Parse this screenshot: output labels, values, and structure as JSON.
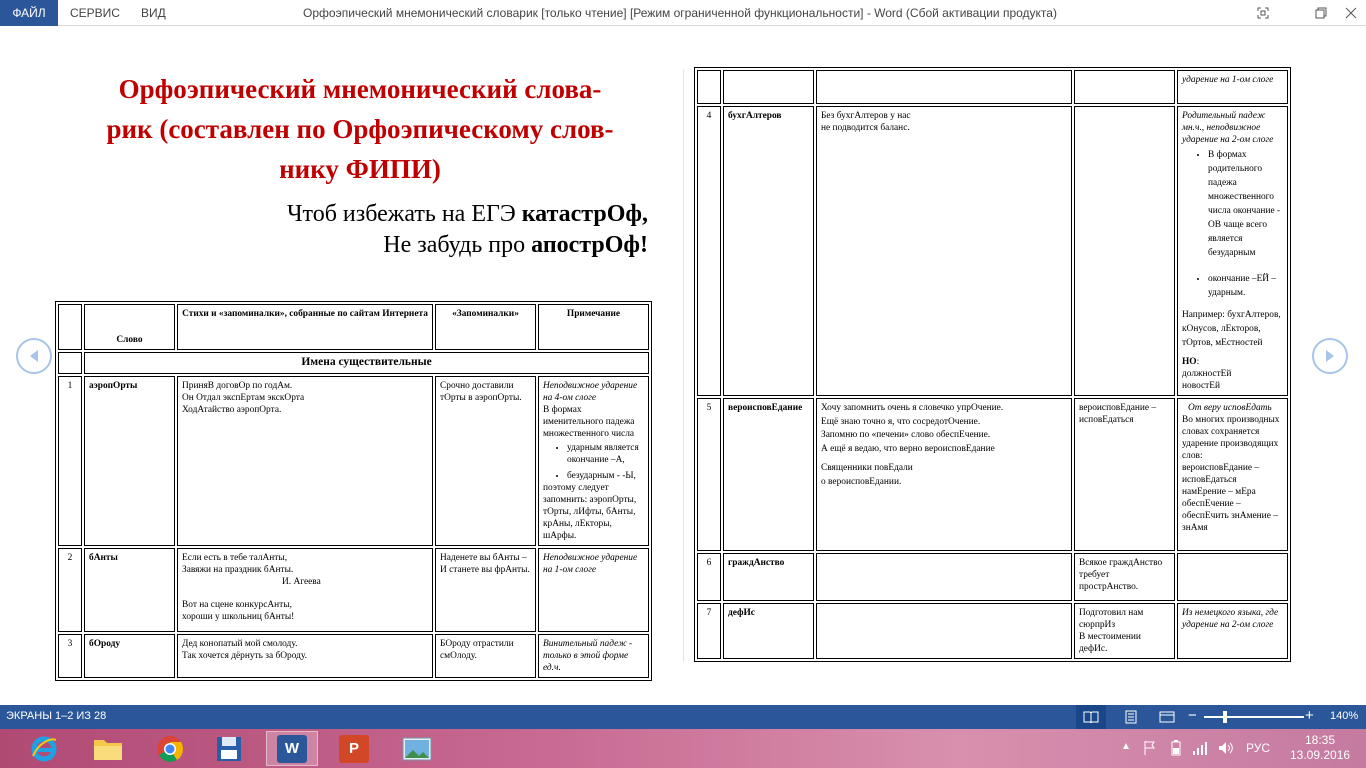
{
  "menu": {
    "file": "ФАЙЛ",
    "service": "СЕРВИС",
    "view": "ВИД"
  },
  "window": {
    "title": "Орфоэпический мнемонический словарик [только чтение] [Режим ограниченной функциональности] - Word (Сбой активации продукта)"
  },
  "doc": {
    "title_l1": "Орфоэпический мнемонический слова-",
    "title_l2": "рик (составлен по Орфоэпическому  слов-",
    "title_l3": "нику  ФИПИ)",
    "epi_l1_pre": "Чтоб избежать на ЕГЭ ",
    "epi_l1_bold": "катастрОф,",
    "epi_l2_pre": "Не забудь про ",
    "epi_l2_bold": "апострОф!"
  },
  "table1": {
    "h_word": "Слово",
    "h_poems": "Стихи и «запоминалки», собранные по сайтам Интернета",
    "h_mnem": "«Запоминалки»",
    "h_note": "Примечание",
    "section": "Имена существительные",
    "r1": {
      "n": "1",
      "word": "аэропОрты",
      "poem": [
        "ПриняВ договОр по годАм.",
        "Он Отдал экспЕртам экскОрта",
        "ХодАтайство аэропОрта."
      ],
      "mnem": "Срочно доставили тОрты в аэропОрты.",
      "note_i": "Неподвижное  ударение на 4-ом слоге",
      "note_t": "В формах именительного падежа множественного числа",
      "note_li1": "ударным является окончание –А,",
      "note_li2": "безударным - -Ы,",
      "note_t2": "поэтому следует запомнить: аэропОрты, тОрты, лИфты, бАнты, крАны, лЕкторы, шАрфы."
    },
    "r2": {
      "n": "2",
      "word": "бАнты",
      "poem1": [
        "Если есть в тебе талАнты,",
        "Завяжи на праздник бАнты."
      ],
      "author": "И.  Агеева",
      "poem2": [
        "Вот на сцене конкурсАнты,",
        "хороши у школьниц бАнты!"
      ],
      "mnem": "Наденете вы бАнты – И станете вы фрАнты.",
      "note_i": "Неподвижное  ударение на 1-ом слоге"
    },
    "r3": {
      "n": "3",
      "word": "бОроду",
      "poem": [
        "Дед конопатый мой смолоду.",
        "Так хочется дёрнуть за бОроду."
      ],
      "mnem": "БОроду отрастили смОлоду.",
      "note_i": "Винительный  падеж - только в этой форме ед.ч."
    }
  },
  "table2": {
    "r0": {
      "note_i": "ударение на 1-ом слоге"
    },
    "r4": {
      "n": "4",
      "word": "бухгАлтеров",
      "poem": [
        "Без бухгАлтеров у нас",
        "не подводится баланс."
      ],
      "note_i": "Родительный падеж мн.ч.,  неподвижное ударение     на 2-ом слоге",
      "li1": "В формах родительного падежа множественного числа окончание - ОВ чаще всего является безударным",
      "li2": "окончание –ЕЙ – ударным.",
      "example": "Например: бухгАлтеров, кОнусов, лЕкторов, тОртов, мЕстностей",
      "but": "НО",
      "but_rest": [
        "должностЕй",
        "новостЕй"
      ]
    },
    "r5": {
      "n": "5",
      "word": "вероисповЕдание",
      "poem1": [
        "Хочу запомнить очень я словечко упрОчение.",
        "Ещё знаю точно я, что сосредотОчение.",
        "Запомню по «печени» слово обеспЕчение.",
        "А ещё я ведаю, что верно вероисповЕдание"
      ],
      "poem2": [
        "Священники повЕдали",
        "о вероисповЕдании."
      ],
      "mnem": "вероисповЕдание – исповЕдаться",
      "note_i": "От веру исповЕдать",
      "note_t": "Во многих производных словах сохраняется ударение производящих слов:",
      "note_lines": [
        "вероисповЕдание –",
        "исповЕдаться",
        "намЕрение – мЕра",
        "обеспЕчение –",
        "обеспЕчить  знАмение –",
        "знАмя"
      ]
    },
    "r6": {
      "n": "6",
      "word": "граждАнство",
      "mnem": "Всякое граждАнство требует прострАнство."
    },
    "r7": {
      "n": "7",
      "word": "дефИс",
      "mnem": [
        "Подготовил нам сюрпрИз",
        "В местоимении дефИс."
      ],
      "note_i": "Из немецкого языка, где ударение на 2-ом слоге"
    }
  },
  "status": {
    "screens": "ЭКРАНЫ 1–2 ИЗ 28",
    "zoom": "140%"
  },
  "taskbar": {
    "lang": "РУС",
    "time": "18:35",
    "date": "13.09.2016"
  },
  "colors": {
    "accent": "#2b579a",
    "title_red": "#c00000"
  }
}
